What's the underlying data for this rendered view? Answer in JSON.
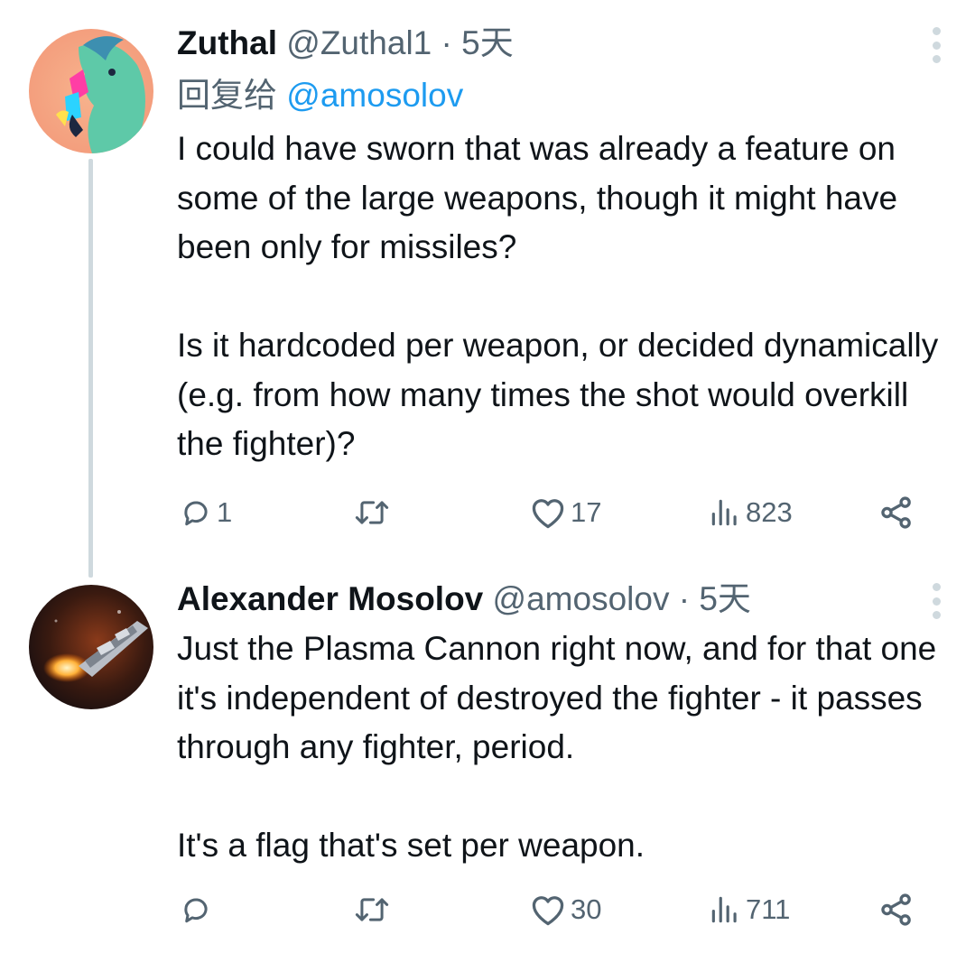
{
  "tweets": [
    {
      "author_name": "Zuthal",
      "handle": "@Zuthal1",
      "separator": "·",
      "time": "5天",
      "replying_prefix": "回复给",
      "replying_to": "@amosolov",
      "paragraphs": [
        "I could have sworn that was already a feature on some of the large weapons, though it might have been only for missiles?",
        "Is it hardcoded per weapon, or decided dynamically (e.g. from how many times the shot would overkill the fighter)?"
      ],
      "replies": "1",
      "retweets": "",
      "likes": "17",
      "views": "823",
      "avatar_icon": "teal-pony-avatar"
    },
    {
      "author_name": "Alexander Mosolov",
      "handle": "@amosolov",
      "separator": "·",
      "time": "5天",
      "paragraphs": [
        "Just the Plasma Cannon right now, and for that one it's independent of destroyed the fighter - it passes through any fighter, period.",
        "It's a flag that's set per weapon."
      ],
      "replies": "",
      "retweets": "",
      "likes": "30",
      "views": "711",
      "avatar_icon": "spaceship-avatar"
    }
  ],
  "icons": {
    "reply": "reply-icon",
    "retweet": "retweet-icon",
    "like": "heart-icon",
    "views": "views-chart-icon",
    "share": "share-icon",
    "more": "more-vertical-icon"
  },
  "colors": {
    "text": "#0f1419",
    "secondary": "#536471",
    "link": "#1d9bf0",
    "thread_line": "#cfd9de"
  }
}
